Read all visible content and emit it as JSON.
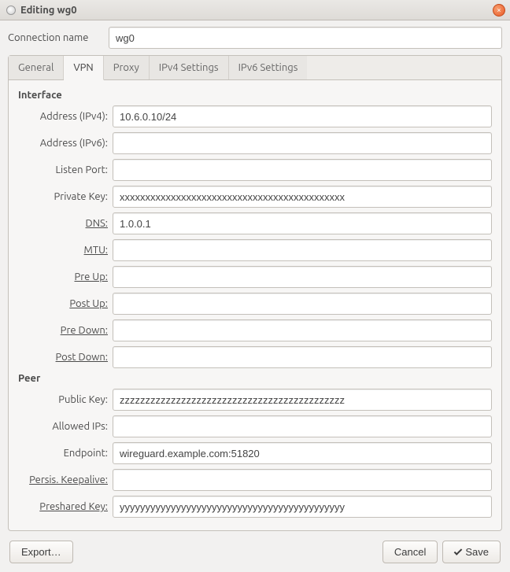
{
  "window": {
    "title": "Editing wg0",
    "close_glyph": "×"
  },
  "top": {
    "conn_name_label": "Connection name",
    "conn_name_value": "wg0"
  },
  "tabs": {
    "general": "General",
    "vpn": "VPN",
    "proxy": "Proxy",
    "ipv4": "IPv4 Settings",
    "ipv6": "IPv6 Settings",
    "active_index": 1
  },
  "sections": {
    "interface": "Interface",
    "peer": "Peer"
  },
  "interface": {
    "addr4_label": "Address (IPv4):",
    "addr4_value": "10.6.0.10/24",
    "addr6_label": "Address (IPv6):",
    "addr6_value": "",
    "listen_label": "Listen Port:",
    "listen_value": "",
    "privkey_label": "Private Key:",
    "privkey_value": "xxxxxxxxxxxxxxxxxxxxxxxxxxxxxxxxxxxxxxxxxxxx",
    "dns_label": "DNS:",
    "dns_value": "1.0.0.1",
    "mtu_label": "MTU:",
    "mtu_value": "",
    "preup_label": "Pre Up:",
    "preup_value": "",
    "postup_label": "Post Up:",
    "postup_value": "",
    "predown_label": "Pre Down:",
    "predown_value": "",
    "postdown_label": "Post Down:",
    "postdown_value": ""
  },
  "peer": {
    "pubkey_label": "Public Key:",
    "pubkey_value": "zzzzzzzzzzzzzzzzzzzzzzzzzzzzzzzzzzzzzzzzzzzz",
    "allowed_label": "Allowed IPs:",
    "allowed_value": "",
    "endpoint_label": "Endpoint:",
    "endpoint_value": "wireguard.example.com:51820",
    "keepalive_label": "Persis. Keepalive:",
    "keepalive_value": "",
    "psk_label": "Preshared Key:",
    "psk_value": "yyyyyyyyyyyyyyyyyyyyyyyyyyyyyyyyyyyyyyyyyyyy"
  },
  "buttons": {
    "export": "Export…",
    "cancel": "Cancel",
    "save": "Save"
  }
}
